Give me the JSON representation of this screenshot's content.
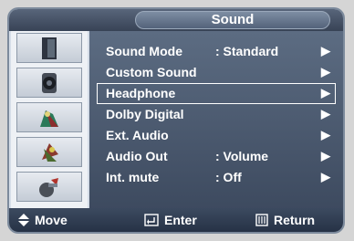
{
  "menu": {
    "title": "Sound",
    "items": [
      {
        "label": "Sound Mode",
        "value": ": Standard"
      },
      {
        "label": "Custom Sound",
        "value": ""
      },
      {
        "label": "Headphone",
        "value": ""
      },
      {
        "label": "Dolby Digital",
        "value": ""
      },
      {
        "label": "Ext. Audio",
        "value": ""
      },
      {
        "label": "Audio Out",
        "value": ": Volume"
      },
      {
        "label": "Int. mute",
        "value": ": Off"
      }
    ],
    "arrow": "▶"
  },
  "sidebar": {
    "icons": [
      "picture-icon",
      "sound-icon",
      "channel-icon",
      "setup-icon",
      "input-icon"
    ]
  },
  "footer": {
    "move_label": "Move",
    "enter_label": "Enter",
    "return_label": "Return"
  }
}
